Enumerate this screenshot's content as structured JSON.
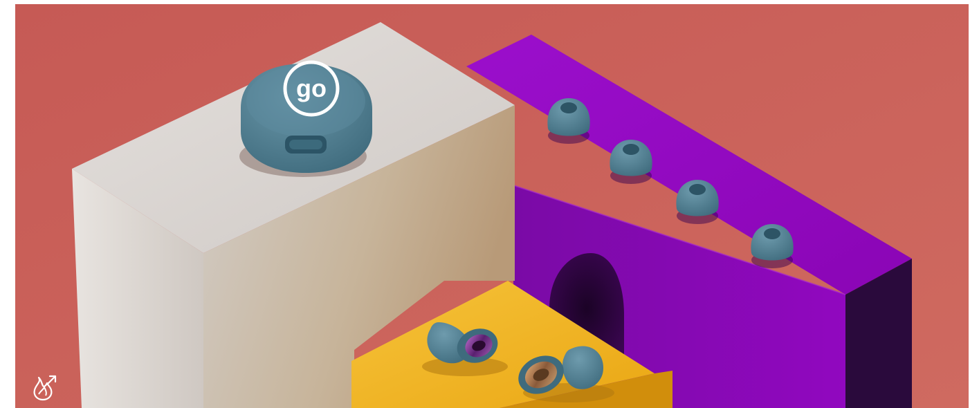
{
  "scene": {
    "case_logo_text": "go",
    "colors": {
      "background": "#c9605a",
      "white_block": "#d8d3cf",
      "purple_block": "#8a08b8",
      "yellow_block": "#f0b51e",
      "product_blue": "#4f8093"
    },
    "icons": {
      "corner": "flame-arrow-icon"
    }
  }
}
